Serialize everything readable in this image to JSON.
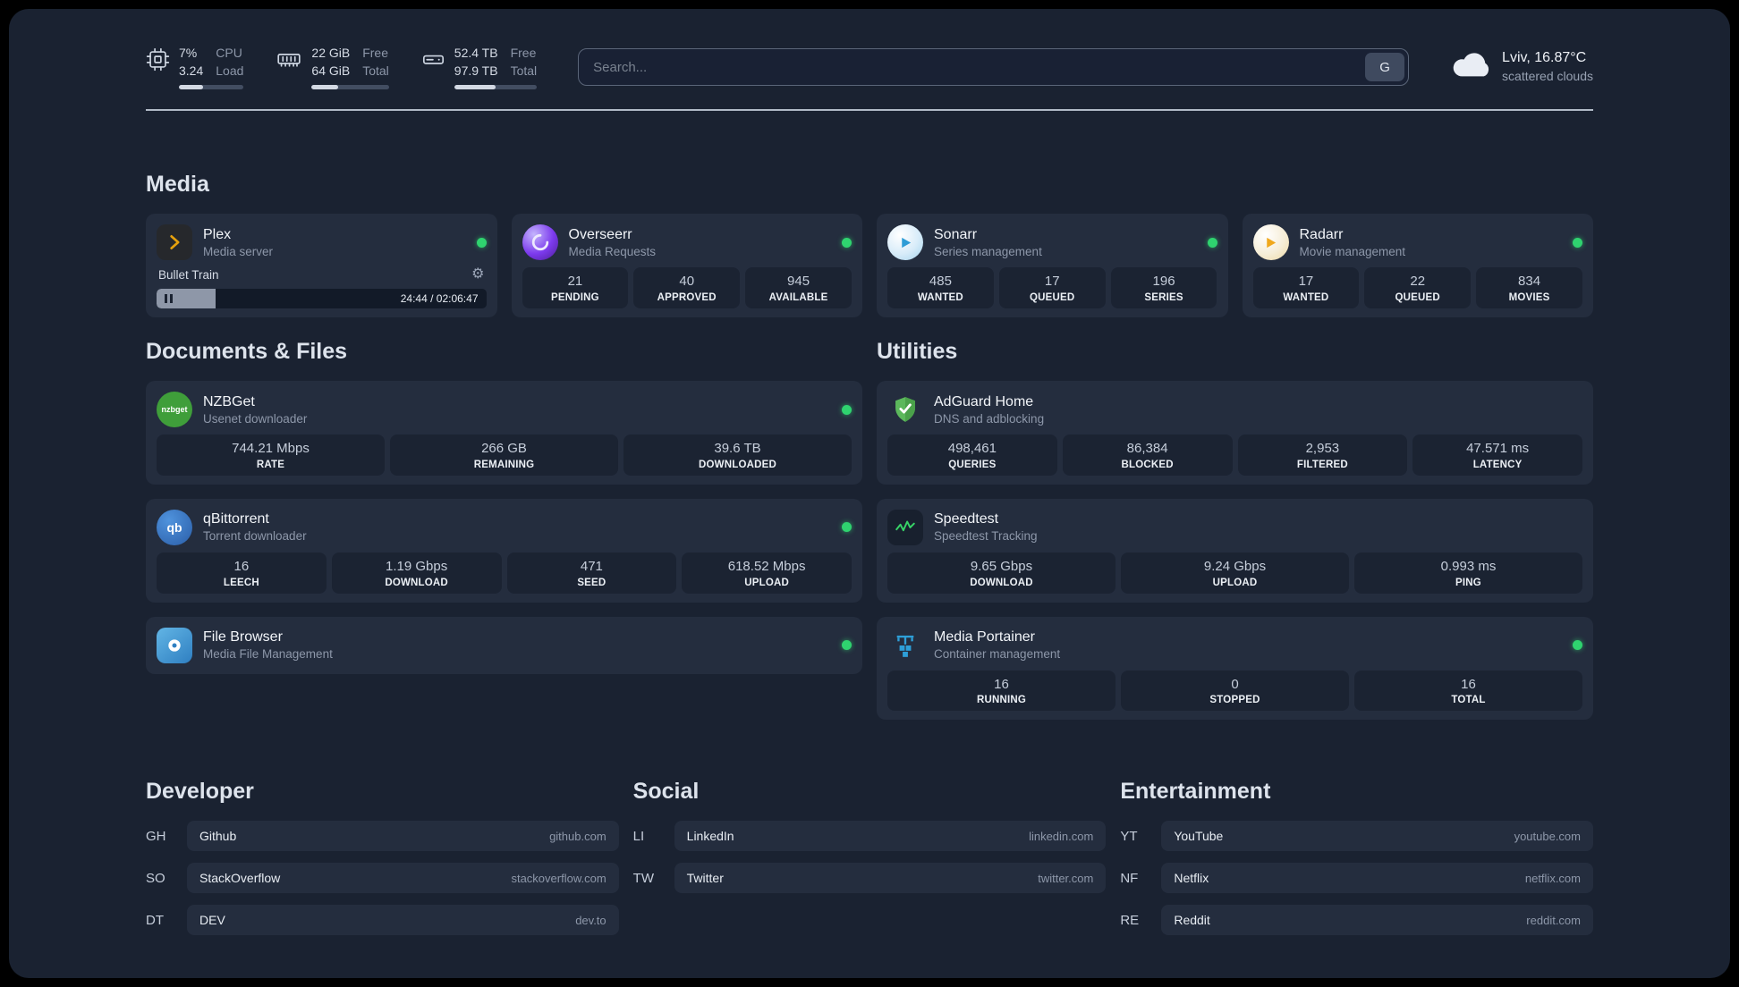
{
  "topbar": {
    "resources": [
      {
        "icon": "cpu-icon",
        "value1": "7%",
        "value2": "3.24",
        "label1": "CPU",
        "label2": "Load",
        "progress": 37
      },
      {
        "icon": "memory-icon",
        "value1": "22 GiB",
        "value2": "64 GiB",
        "label1": "Free",
        "label2": "Total",
        "progress": 34
      },
      {
        "icon": "disk-icon",
        "value1": "52.4 TB",
        "value2": "97.9 TB",
        "label1": "Free",
        "label2": "Total",
        "progress": 50
      }
    ],
    "search": {
      "placeholder": "Search...",
      "provider_button": "G"
    },
    "weather": {
      "location": "Lviv, 16.87°C",
      "condition": "scattered clouds"
    }
  },
  "media": {
    "title": "Media",
    "plex": {
      "name": "Plex",
      "desc": "Media server",
      "status": "online",
      "player": {
        "track": "Bullet Train",
        "time": "24:44 / 02:06:47",
        "progress": 18
      }
    },
    "overseerr": {
      "name": "Overseerr",
      "desc": "Media Requests",
      "status": "online",
      "stats": [
        {
          "value": "21",
          "label": "PENDING"
        },
        {
          "value": "40",
          "label": "APPROVED"
        },
        {
          "value": "945",
          "label": "AVAILABLE"
        }
      ]
    },
    "sonarr": {
      "name": "Sonarr",
      "desc": "Series management",
      "status": "online",
      "stats": [
        {
          "value": "485",
          "label": "WANTED"
        },
        {
          "value": "17",
          "label": "QUEUED"
        },
        {
          "value": "196",
          "label": "SERIES"
        }
      ]
    },
    "radarr": {
      "name": "Radarr",
      "desc": "Movie management",
      "status": "online",
      "stats": [
        {
          "value": "17",
          "label": "WANTED"
        },
        {
          "value": "22",
          "label": "QUEUED"
        },
        {
          "value": "834",
          "label": "MOVIES"
        }
      ]
    }
  },
  "documents": {
    "title": "Documents & Files",
    "nzbget": {
      "name": "NZBGet",
      "desc": "Usenet downloader",
      "status": "online",
      "icon_text": "nzbget",
      "stats": [
        {
          "value": "744.21 Mbps",
          "label": "RATE"
        },
        {
          "value": "266 GB",
          "label": "REMAINING"
        },
        {
          "value": "39.6 TB",
          "label": "DOWNLOADED"
        }
      ]
    },
    "qbittorrent": {
      "name": "qBittorrent",
      "desc": "Torrent downloader",
      "status": "online",
      "icon_text": "qb",
      "stats": [
        {
          "value": "16",
          "label": "LEECH"
        },
        {
          "value": "1.19 Gbps",
          "label": "DOWNLOAD"
        },
        {
          "value": "471",
          "label": "SEED"
        },
        {
          "value": "618.52 Mbps",
          "label": "UPLOAD"
        }
      ]
    },
    "filebrowser": {
      "name": "File Browser",
      "desc": "Media File Management",
      "status": "online"
    }
  },
  "utilities": {
    "title": "Utilities",
    "adguard": {
      "name": "AdGuard Home",
      "desc": "DNS and adblocking",
      "stats": [
        {
          "value": "498,461",
          "label": "QUERIES"
        },
        {
          "value": "86,384",
          "label": "BLOCKED"
        },
        {
          "value": "2,953",
          "label": "FILTERED"
        },
        {
          "value": "47.571 ms",
          "label": "LATENCY"
        }
      ]
    },
    "speedtest": {
      "name": "Speedtest",
      "desc": "Speedtest Tracking",
      "stats": [
        {
          "value": "9.65 Gbps",
          "label": "DOWNLOAD"
        },
        {
          "value": "9.24 Gbps",
          "label": "UPLOAD"
        },
        {
          "value": "0.993 ms",
          "label": "PING"
        }
      ]
    },
    "portainer": {
      "name": "Media Portainer",
      "desc": "Container management",
      "status": "online",
      "stats": [
        {
          "value": "16",
          "label": "RUNNING"
        },
        {
          "value": "0",
          "label": "STOPPED"
        },
        {
          "value": "16",
          "label": "TOTAL"
        }
      ]
    }
  },
  "bookmarks": {
    "developer": {
      "title": "Developer",
      "items": [
        {
          "abbr": "GH",
          "name": "Github",
          "url": "github.com"
        },
        {
          "abbr": "SO",
          "name": "StackOverflow",
          "url": "stackoverflow.com"
        },
        {
          "abbr": "DT",
          "name": "DEV",
          "url": "dev.to"
        }
      ]
    },
    "social": {
      "title": "Social",
      "items": [
        {
          "abbr": "LI",
          "name": "LinkedIn",
          "url": "linkedin.com"
        },
        {
          "abbr": "TW",
          "name": "Twitter",
          "url": "twitter.com"
        }
      ]
    },
    "entertainment": {
      "title": "Entertainment",
      "items": [
        {
          "abbr": "YT",
          "name": "YouTube",
          "url": "youtube.com"
        },
        {
          "abbr": "NF",
          "name": "Netflix",
          "url": "netflix.com"
        },
        {
          "abbr": "RE",
          "name": "Reddit",
          "url": "reddit.com"
        }
      ]
    }
  },
  "colors": {
    "status_online": "#2fd36f",
    "card_bg": "#242d3e",
    "page_bg": "#1a2231"
  }
}
